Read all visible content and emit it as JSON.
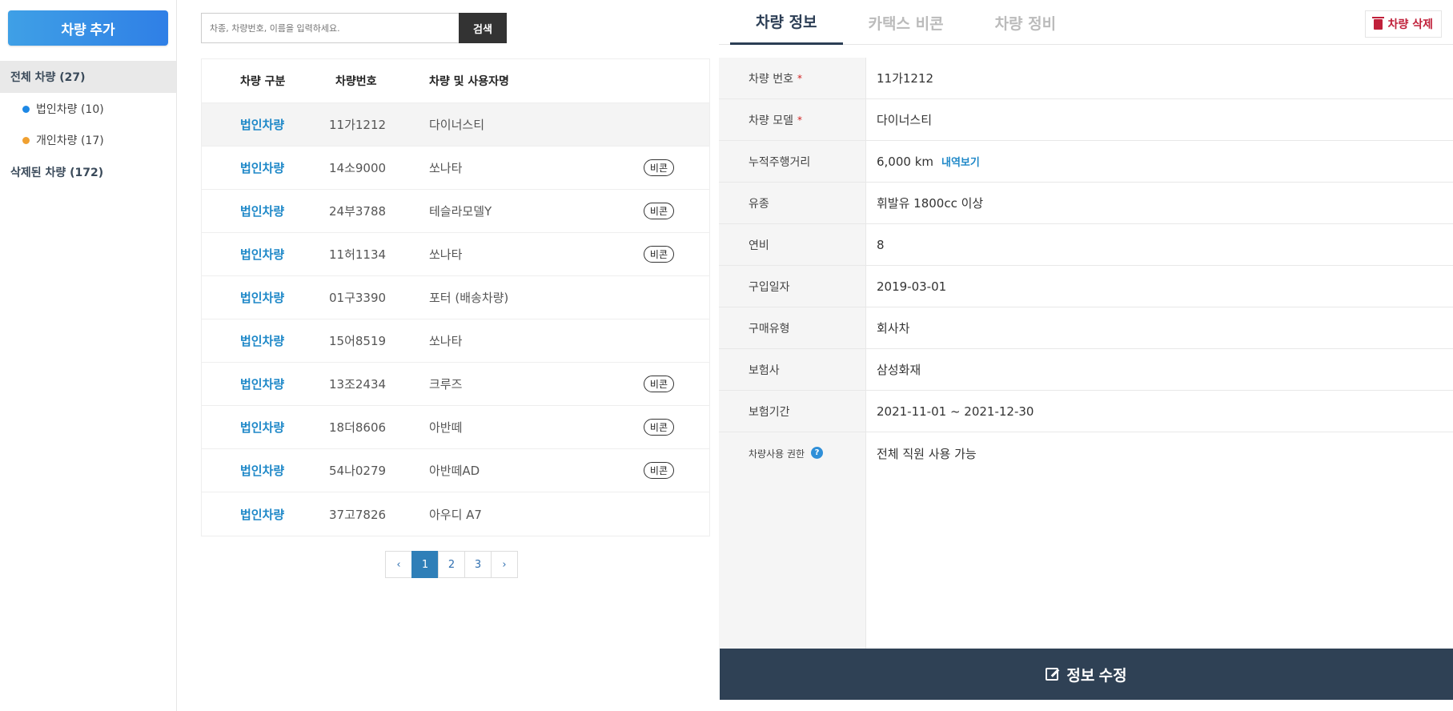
{
  "sidebar": {
    "add_button": "차량 추가",
    "all": "전체 차량 (27)",
    "corp": "법인차량 (10)",
    "personal": "개인차량 (17)",
    "deleted": "삭제된 차량 (172)",
    "corp_color": "#1e88e5",
    "personal_color": "#f0a030"
  },
  "search": {
    "placeholder": "차종, 차량번호, 이름을 입력하세요.",
    "button": "검색"
  },
  "list": {
    "headers": [
      "차량 구분",
      "차량번호",
      "차량 및 사용자명"
    ],
    "rows": [
      {
        "type": "법인차량",
        "plate": "11가1212",
        "model": "다이너스티",
        "beacon": ""
      },
      {
        "type": "법인차량",
        "plate": "14소9000",
        "model": "쏘나타",
        "beacon": "비콘"
      },
      {
        "type": "법인차량",
        "plate": "24부3788",
        "model": "테슬라모델Y",
        "beacon": "비콘"
      },
      {
        "type": "법인차량",
        "plate": "11허1134",
        "model": "쏘나타",
        "beacon": "비콘"
      },
      {
        "type": "법인차량",
        "plate": "01구3390",
        "model": "포터 (배송차량)",
        "beacon": ""
      },
      {
        "type": "법인차량",
        "plate": "15어8519",
        "model": "쏘나타",
        "beacon": ""
      },
      {
        "type": "법인차량",
        "plate": "13조2434",
        "model": "크루즈",
        "beacon": "비콘"
      },
      {
        "type": "법인차량",
        "plate": "18더8606",
        "model": "아반떼",
        "beacon": "비콘"
      },
      {
        "type": "법인차량",
        "plate": "54나0279",
        "model": "아반떼AD",
        "beacon": "비콘"
      },
      {
        "type": "법인차량",
        "plate": "37고7826",
        "model": "아우디 A7",
        "beacon": ""
      }
    ]
  },
  "pagination": {
    "prev": "‹",
    "pages": [
      "1",
      "2",
      "3"
    ],
    "next": "›",
    "current": "1"
  },
  "detail": {
    "tabs": [
      "차량 정보",
      "카택스 비콘",
      "차량 정비"
    ],
    "delete_button": "차량 삭제",
    "fields": [
      {
        "label": "차량 번호",
        "value": "11가1212",
        "required": "*"
      },
      {
        "label": "차량 모델",
        "value": "다이너스티",
        "required": "*"
      },
      {
        "label": "누적주행거리",
        "value": "6,000 km",
        "link": "내역보기"
      },
      {
        "label": "유종",
        "value": "휘발유 1800cc 이상"
      },
      {
        "label": "연비",
        "value": "8"
      },
      {
        "label": "구입일자",
        "value": "2019-03-01"
      },
      {
        "label": "구매유형",
        "value": "회사차"
      },
      {
        "label": "보험사",
        "value": "삼성화재"
      },
      {
        "label": "보험기간",
        "value": "2021-11-01 ~ 2021-12-30"
      },
      {
        "label": "차량사용 권한",
        "value": "전체 직원 사용 가능",
        "help": "?"
      }
    ],
    "edit_button": "정보 수정"
  }
}
